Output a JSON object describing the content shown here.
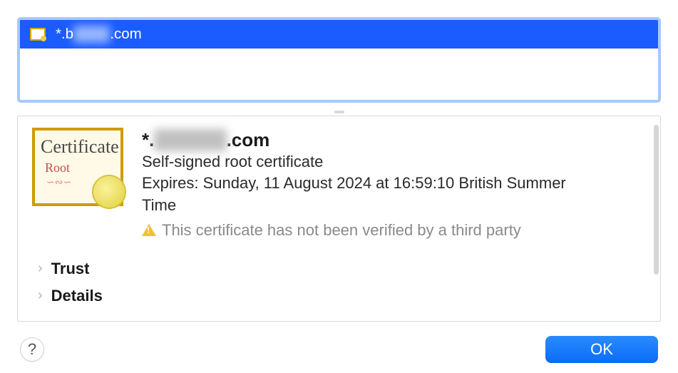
{
  "cert_list": {
    "selected": {
      "prefix": "*.b",
      "redacted": "xxxxx",
      "suffix": ".com"
    }
  },
  "cert_icon": {
    "script": "Certificate",
    "root": "Root",
    "flourish": "∽∾∽"
  },
  "cert": {
    "title_prefix": "*.",
    "title_redacted": "xxxxxxx",
    "title_suffix": ".com",
    "subtitle": "Self-signed root certificate",
    "expires": "Expires: Sunday, 11 August 2024 at 16:59:10 British Summer Time",
    "warning": "This certificate has not been verified by a third party"
  },
  "disclosures": {
    "trust": "Trust",
    "details": "Details"
  },
  "footer": {
    "help": "?",
    "ok": "OK"
  }
}
